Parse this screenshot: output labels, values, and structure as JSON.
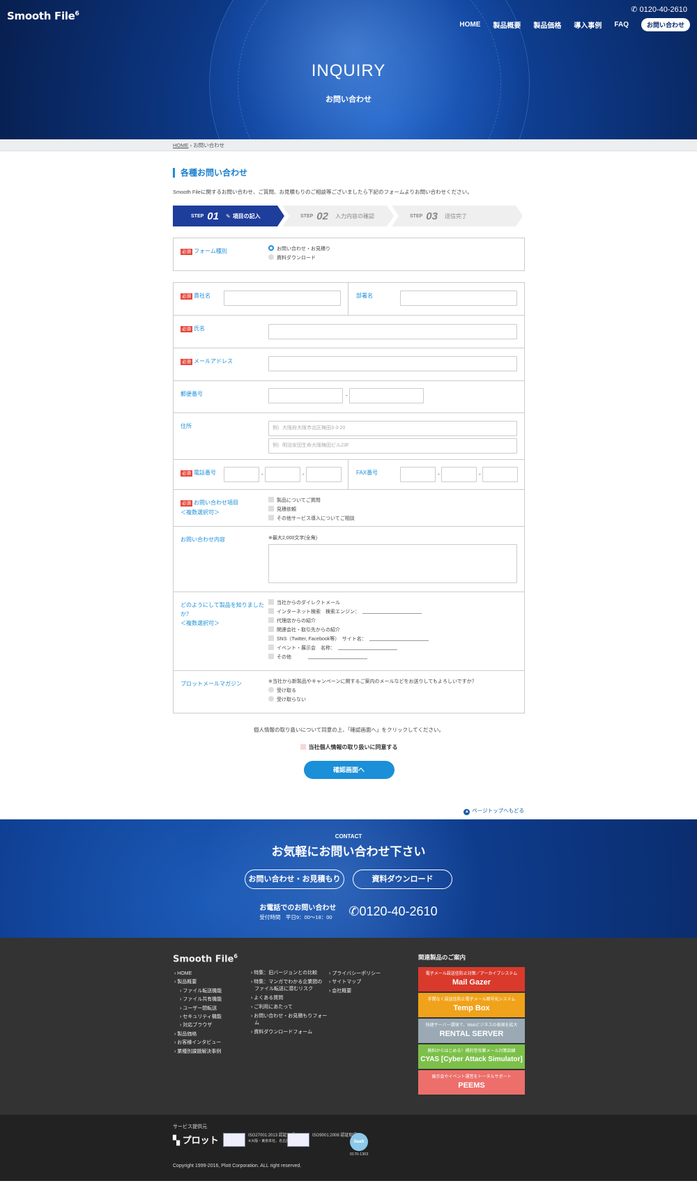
{
  "header": {
    "logo": "Smooth File",
    "logo_version": "6",
    "tel": "0120-40-2610",
    "nav": [
      "HOME",
      "製品概要",
      "製品価格",
      "導入事例",
      "FAQ",
      "お問い合わせ"
    ]
  },
  "hero": {
    "title": "INQUIRY",
    "subtitle": "お問い合わせ"
  },
  "breadcrumb": {
    "home": "HOME",
    "sep": "›",
    "current": "お問い合わせ"
  },
  "section": {
    "title": "各種お問い合わせ",
    "lead": "Smooth Fileに関するお問い合わせ、ご質問、お見積もりのご相談等ございましたら下記のフォームよりお問い合わせください。"
  },
  "steps": [
    {
      "label": "STEP",
      "num": "01",
      "text": "項目の記入"
    },
    {
      "label": "STEP",
      "num": "02",
      "text": "入力内容の確認"
    },
    {
      "label": "STEP",
      "num": "03",
      "text": "送信完了"
    }
  ],
  "form": {
    "required": "必須",
    "form_type": {
      "label": "フォーム種別",
      "options": [
        "お問い合わせ・お見積り",
        "資料ダウンロード"
      ],
      "selected": "お問い合わせ・お見積り"
    },
    "company": "貴社名",
    "department": "部署名",
    "name": "氏名",
    "email": "メールアドレス",
    "postal": "郵便番号",
    "dash": "-",
    "address": {
      "label": "住所",
      "placeholder1": "例）大阪府大阪市北区梅田3-3-20",
      "placeholder2": "例）明治安田生命大阪梅田ビル23F"
    },
    "phone": "電話番号",
    "fax": "FAX番号",
    "inquiry_items": {
      "label": "お問い合わせ項目",
      "note": "＜複数選択可＞",
      "options": [
        "製品についてご質問",
        "見積依頼",
        "その他サービス導入についてご相談"
      ]
    },
    "inquiry_content": {
      "label": "お問い合わせ内容",
      "note": "※最大2,000文字(全角)"
    },
    "source": {
      "label": "どのようにして製品を知りましたか？",
      "note": "＜複数選択可＞",
      "options": [
        "当社からのダイレクトメール",
        "インターネット検索　検索エンジン：",
        "代理店からの紹介",
        "関連会社・取引先からの紹介",
        "SNS（Twitter, Facebook等）　サイト名：",
        "イベント・展示会　名称：",
        "その他"
      ]
    },
    "magazine": {
      "label": "プロットメールマガジン",
      "question": "※当社から新製品やキャンペーンに関するご案内のメールなどをお送りしてもよろしいですか？",
      "options": [
        "受け取る",
        "受け取らない"
      ]
    }
  },
  "agree": {
    "text": "個人情報の取り扱いについて同意の上、「確認画面へ」をクリックしてください。",
    "checkbox": "当社個人情報の取り扱いに同意する",
    "button": "確認画面へ"
  },
  "to_top": "ページトップへもどる",
  "contact": {
    "label": "CONTACT",
    "title": "お気軽にお問い合わせ下さい",
    "btn1": "お問い合わせ・お見積もり",
    "btn2": "資料ダウンロード",
    "phone_title": "お電話でのお問い合わせ",
    "hours": "受付時間　平日9：00〜18：00",
    "phone": "0120-40-2610"
  },
  "footer": {
    "logo": "Smooth File",
    "logo_version": "6",
    "col1": [
      "› HOME",
      "› 製品概要",
      "› ファイル転送機能",
      "› ファイル共有機能",
      "› ユーザー間転送",
      "› セキュリティ機能",
      "› 対応ブラウザ",
      "› 製品価格",
      "› お客様インタビュー",
      "› 業種別課題解決事例"
    ],
    "col2": [
      "› 特集：旧バージョンとの比較",
      "› 特集：マンガでわかる企業間の",
      "ファイル転送に潜むリスク",
      "› よくある質問",
      "› ご利用にあたって",
      "› お問い合わせ・お見積もりフォー",
      "ム",
      "› 資料ダウンロードフォーム"
    ],
    "col3": [
      "› プライバシーポリシー",
      "› サイトマップ",
      "› 会社概要"
    ],
    "related_title": "関連製品のご案内",
    "related": [
      {
        "sub": "電子メール誤送信防止対策／アーカイブシステム",
        "name": "Mail Gazer",
        "color": "#d93a2b"
      },
      {
        "sub": "手間なく誤送信防止電子メール暗号化システム",
        "name": "Temp Box",
        "color": "#f0a21a"
      },
      {
        "sub": "快適サーバー環境で、Webビジネスの表現を拡大",
        "name": "RENTAL SERVER",
        "color": "#9aa9b3"
      },
      {
        "sub": "無料からはじめる！標的型攻撃メール対策訓練",
        "name": "CYAS [Cyber Attack Simulator]",
        "color": "#7cc04a"
      },
      {
        "sub": "展示会やイベント運営をトータルサポート",
        "name": "PEEMS",
        "color": "#ec6f6b"
      }
    ]
  },
  "bottom": {
    "provider": "サービス提供元",
    "company_logo": "プロット",
    "cert1": "ISO27001:2013 認証取得",
    "cert1_note": "※大阪・東京本社、名古屋営業所のみ",
    "cert2": "ISO9001:2008 認証取得",
    "saas": "SaaS",
    "saas_no": "0170-1303",
    "copyright": "Copyright 1999-2016, Plott Corporation. ALL right reserved."
  }
}
